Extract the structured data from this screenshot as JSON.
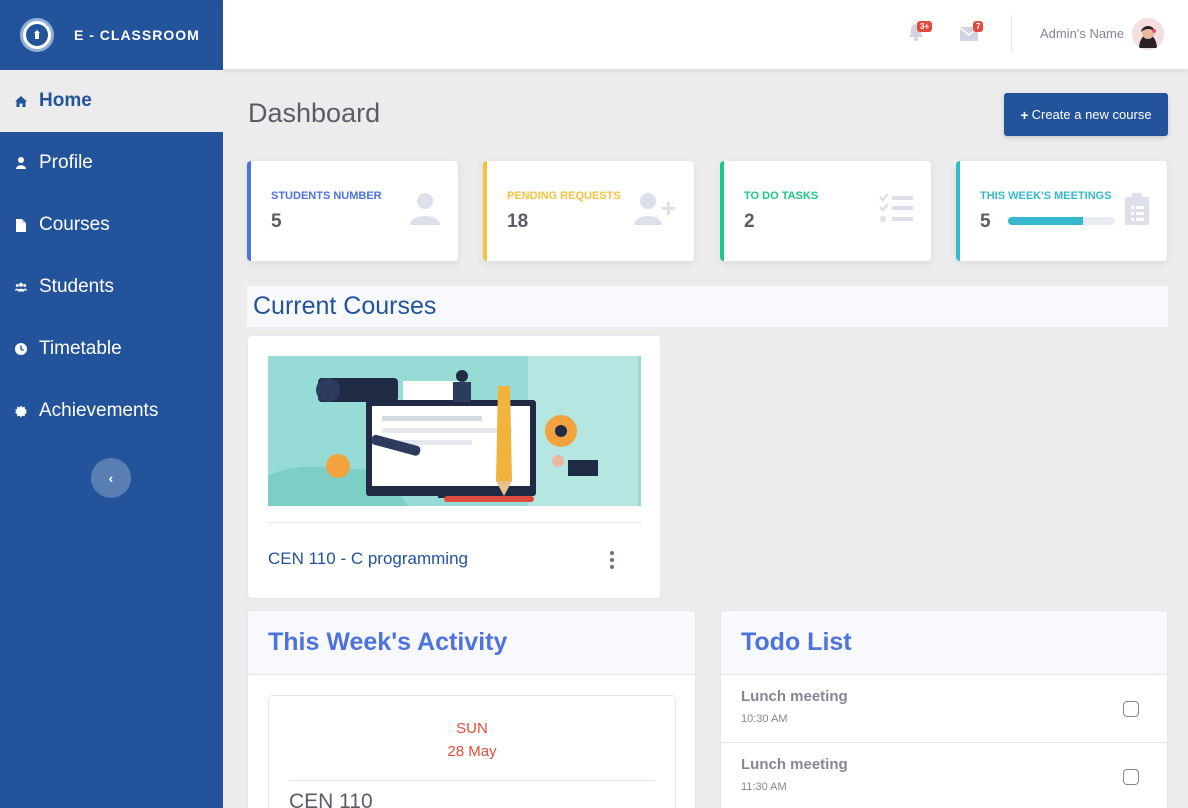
{
  "app": {
    "brand": "E - CLASSROOM"
  },
  "sidebar": {
    "items": [
      {
        "label": "Home",
        "icon": "home-icon",
        "active": true
      },
      {
        "label": "Profile",
        "icon": "user-icon",
        "active": false
      },
      {
        "label": "Courses",
        "icon": "file-icon",
        "active": false
      },
      {
        "label": "Students",
        "icon": "users-icon",
        "active": false
      },
      {
        "label": "Timetable",
        "icon": "clock-icon",
        "active": false
      },
      {
        "label": "Achievements",
        "icon": "certificate-icon",
        "active": false
      }
    ],
    "collapse_glyph": "‹"
  },
  "topbar": {
    "alerts_badge": "3+",
    "messages_badge": "7",
    "user_name": "Admin's Name"
  },
  "main": {
    "title": "Dashboard",
    "create_button": "Create a new course",
    "create_plus": "+"
  },
  "stats": [
    {
      "label": "STUDENTS NUMBER",
      "value": "5",
      "color": "#4e73df",
      "icon": "user-icon"
    },
    {
      "label": "PENDING REQUESTS",
      "value": "18",
      "color": "#f6c23e",
      "icon": "user-plus-icon"
    },
    {
      "label": "TO DO TASKS",
      "value": "2",
      "color": "#1cc88a",
      "icon": "tasks-icon"
    },
    {
      "label": "THIS WEEK'S MEETINGS",
      "value": "5",
      "color": "#36b9cc",
      "icon": "clipboard-icon",
      "progress": 0.7
    }
  ],
  "courses": {
    "section_title": "Current Courses",
    "items": [
      {
        "name": "CEN 110 - C programming"
      }
    ]
  },
  "activity": {
    "title": "This Week's Activity",
    "day": "SUN",
    "date": "28 May",
    "course": "CEN 110"
  },
  "todo": {
    "title": "Todo List",
    "items": [
      {
        "title": "Lunch meeting",
        "time": "10:30 AM"
      },
      {
        "title": "Lunch meeting",
        "time": "11:30 AM"
      }
    ]
  },
  "colors": {
    "primary": "#22539b",
    "accent_blue": "#4e73df",
    "danger": "#e74a3b"
  }
}
